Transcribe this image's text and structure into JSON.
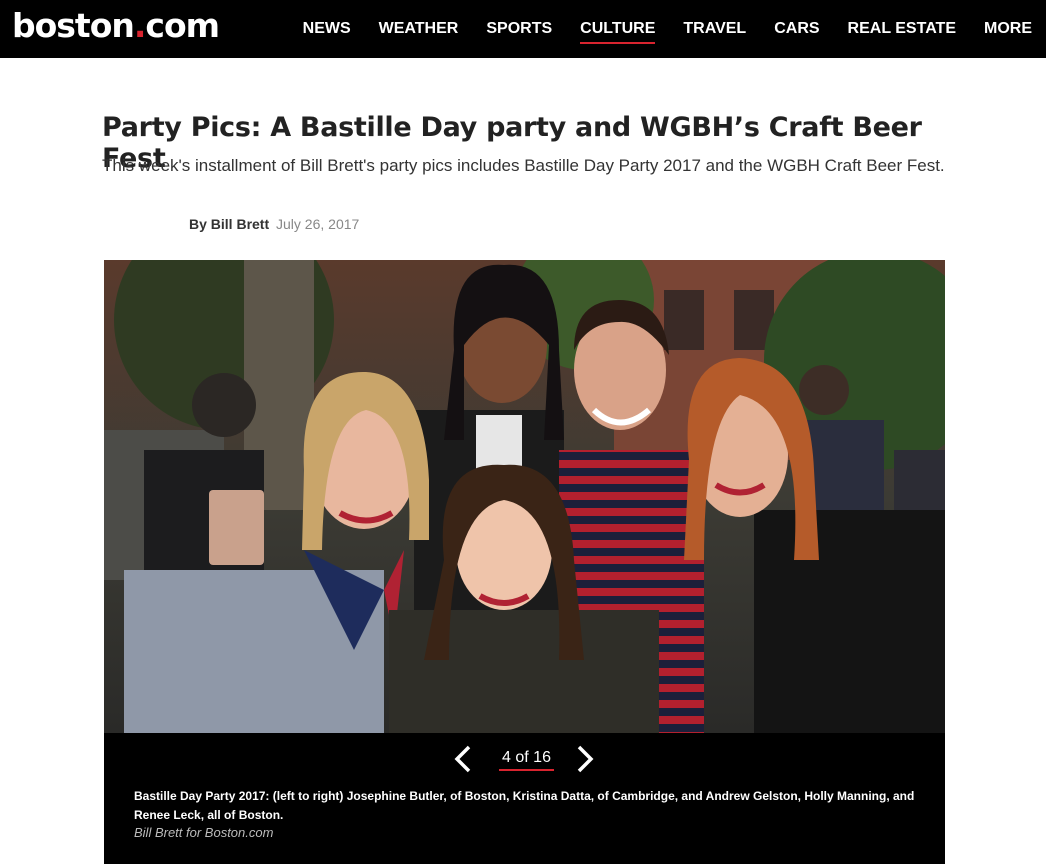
{
  "header": {
    "logo": {
      "name": "boston",
      "dot": ".",
      "tld": "com"
    },
    "nav": [
      {
        "label": "NEWS"
      },
      {
        "label": "WEATHER"
      },
      {
        "label": "SPORTS"
      },
      {
        "label": "CULTURE",
        "active": true
      },
      {
        "label": "TRAVEL"
      },
      {
        "label": "CARS"
      },
      {
        "label": "REAL ESTATE"
      },
      {
        "label": "MORE"
      }
    ]
  },
  "article": {
    "headline": "Party Pics: A Bastille Day party and WGBH’s Craft Beer Fest",
    "dek": "This week's installment of Bill Brett's party pics includes Bastille Day Party 2017 and the WGBH Craft Beer Fest.",
    "byline_author": "By Bill Brett",
    "byline_date": "July 26, 2017"
  },
  "gallery": {
    "counter": "4 of 16",
    "current": 4,
    "total": 16,
    "caption": "Bastille Day Party 2017: (left to right) Josephine Butler, of Boston, Kristina Datta, of Cambridge, and Andrew Gelston, Holly Manning, and Renee Leck, all of Boston.",
    "credit": "Bill Brett for Boston.com"
  },
  "colors": {
    "accent": "#d9242f",
    "bar": "#000000"
  }
}
